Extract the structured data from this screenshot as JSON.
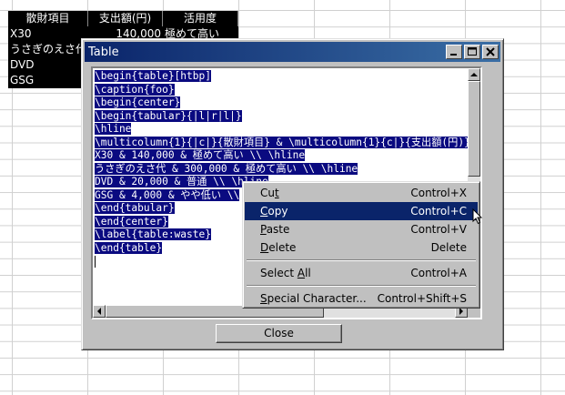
{
  "spreadsheet": {
    "headers": [
      "散財項目",
      "支出額(円)",
      "活用度"
    ],
    "rows": [
      [
        "X30",
        "140,000",
        "極めて高い"
      ],
      [
        "うさぎのえさ代",
        "",
        ""
      ],
      [
        "DVD",
        "",
        ""
      ],
      [
        "GSG",
        "",
        ""
      ]
    ]
  },
  "dialog": {
    "title": "Table",
    "close_label": "Close",
    "code_lines": [
      "\\begin{table}[htbp]",
      "\\caption{foo}",
      "\\begin{center}",
      "\\begin{tabular}{|l|r|l|}",
      "\\hline",
      "\\multicolumn{1}{|c|}{散財項目} & \\multicolumn{1}{c|}{支出額(円)}",
      "X30 & 140,000 & 極めて高い \\\\ \\hline",
      "うさぎのえさ代 & 300,000 & 極めて高い \\\\ \\hline",
      "DVD & 20,000 & 普通 \\\\ \\hline",
      "GSG & 4,000 & やや低い \\\\",
      "\\end{tabular}",
      "\\end{center}",
      "\\label{table:waste}",
      "\\end{table}"
    ]
  },
  "context_menu": {
    "items": [
      {
        "pre": "Cu",
        "u": "t",
        "post": "",
        "shortcut": "Control+X"
      },
      {
        "pre": "",
        "u": "C",
        "post": "opy",
        "shortcut": "Control+C"
      },
      {
        "pre": "",
        "u": "P",
        "post": "aste",
        "shortcut": "Control+V"
      },
      {
        "pre": "",
        "u": "D",
        "post": "elete",
        "shortcut": "Delete"
      },
      {
        "pre": "Select ",
        "u": "A",
        "post": "ll",
        "shortcut": "Control+A"
      },
      {
        "pre": "",
        "u": "S",
        "post": "pecial Character...",
        "shortcut": "Control+Shift+S"
      }
    ]
  },
  "colors": {
    "selection": "#0a0a80",
    "titlebar": "#0a246a",
    "menu_highlight": "#0a246a"
  }
}
